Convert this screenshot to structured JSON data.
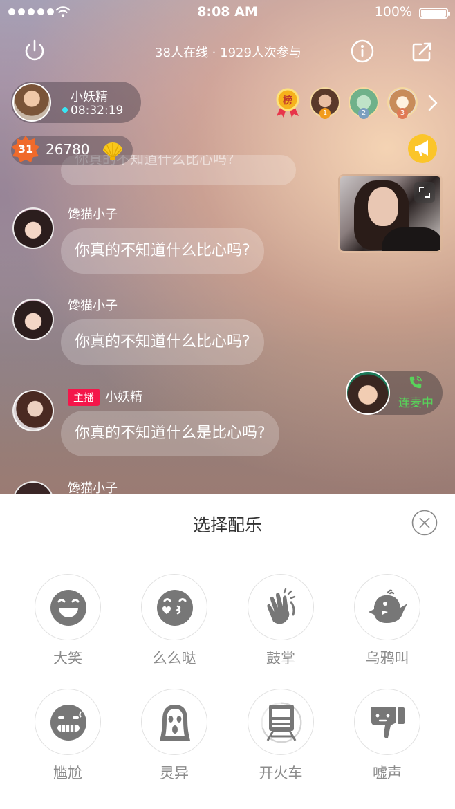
{
  "status_bar": {
    "time": "8:08 AM",
    "battery": "100%"
  },
  "header": {
    "stats": "38人在线 · 1929人次参与"
  },
  "anchor": {
    "name": "小妖精",
    "timer": "08:32:19"
  },
  "rank_badge_text": "榜",
  "top_viewers": [
    {
      "rank": "1"
    },
    {
      "rank": "2"
    },
    {
      "rank": "3"
    }
  ],
  "level": {
    "value": "31",
    "coins": "26780"
  },
  "ghost_message": "你真的不知道什么比心吗?",
  "messages": [
    {
      "name": "馋猫小子",
      "text": "你真的不知道什么比心吗?"
    },
    {
      "name": "馋猫小子",
      "text": "你真的不知道什么比心吗?"
    },
    {
      "tag": "主播",
      "name": "小妖精",
      "text": "你真的不知道什么是比心吗?"
    },
    {
      "name": "馋猫小子"
    }
  ],
  "mic": {
    "label": "连麦中"
  },
  "sheet": {
    "title": "选择配乐",
    "items": [
      {
        "label": "大笑",
        "icon": "laugh-icon"
      },
      {
        "label": "么么哒",
        "icon": "kiss-icon"
      },
      {
        "label": "鼓掌",
        "icon": "clap-icon"
      },
      {
        "label": "乌鸦叫",
        "icon": "crow-icon"
      },
      {
        "label": "尴尬",
        "icon": "awkward-icon"
      },
      {
        "label": "灵异",
        "icon": "ghost-icon"
      },
      {
        "label": "开火车",
        "icon": "train-icon",
        "progress": 0.7
      },
      {
        "label": "嘘声",
        "icon": "thumbs-down-icon"
      }
    ]
  },
  "colors": {
    "host_tag": "#f4164a",
    "mic_green": "#58d25a",
    "megaphone": "#fbc52a",
    "online_dot": "#38e5f4"
  }
}
